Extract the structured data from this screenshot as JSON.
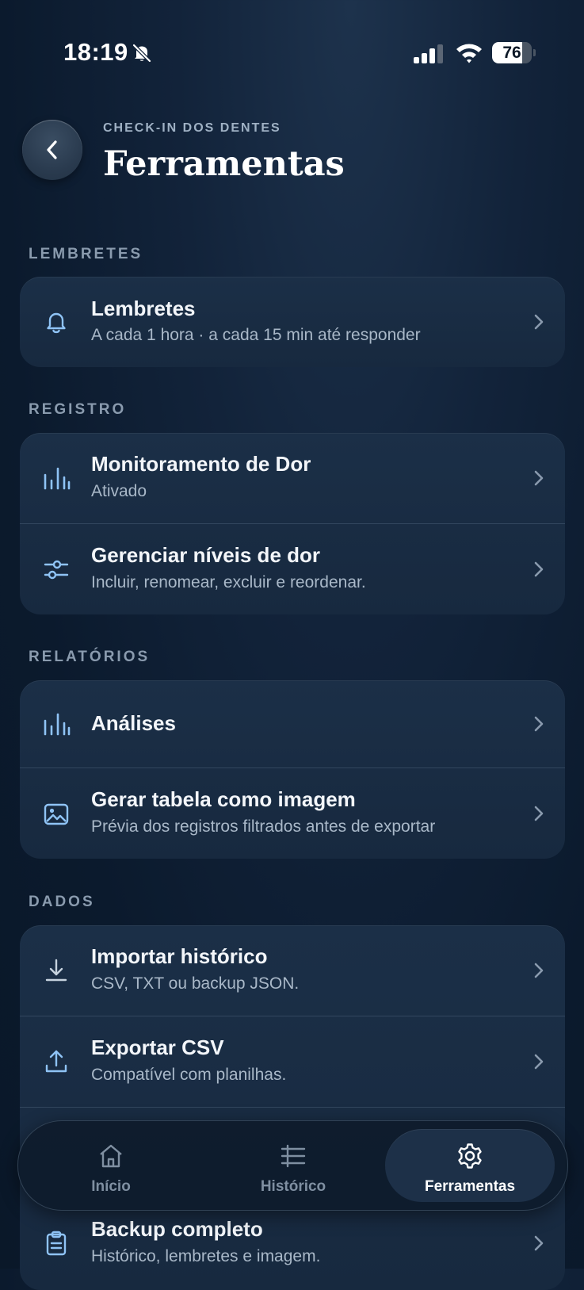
{
  "status_bar": {
    "time": "18:19",
    "battery": "76",
    "battery_level": 0.76
  },
  "header": {
    "eyebrow": "CHECK-IN DOS DENTES",
    "title": "Ferramentas"
  },
  "sections": {
    "lembretes": {
      "label": "LEMBRETES",
      "items": [
        {
          "title": "Lembretes",
          "subtitle": "A cada 1 hora · a cada 15 min até responder",
          "icon": "bell-icon"
        }
      ]
    },
    "registro": {
      "label": "REGISTRO",
      "items": [
        {
          "title": "Monitoramento de Dor",
          "subtitle": "Ativado",
          "icon": "bar-chart-icon"
        },
        {
          "title": "Gerenciar níveis de dor",
          "subtitle": "Incluir, renomear, excluir e reordenar.",
          "icon": "sliders-icon"
        }
      ]
    },
    "relatorios": {
      "label": "RELATÓRIOS",
      "items": [
        {
          "title": "Análises",
          "icon": "bar-chart-icon"
        },
        {
          "title": "Gerar tabela como imagem",
          "subtitle": "Prévia dos registros filtrados antes de exportar",
          "icon": "image-icon"
        }
      ]
    },
    "dados": {
      "label": "DADOS",
      "items": [
        {
          "title": "Importar histórico",
          "subtitle": "CSV, TXT ou backup JSON.",
          "icon": "download-icon"
        },
        {
          "title": "Exportar CSV",
          "subtitle": "Compatível com planilhas.",
          "icon": "upload-icon"
        },
        {
          "title": "Backup completo",
          "subtitle": "Histórico, lembretes e imagem.",
          "icon": "clipboard-icon"
        }
      ]
    }
  },
  "tab_bar": {
    "tabs": [
      {
        "label": "Início",
        "icon": "home-icon",
        "active": false
      },
      {
        "label": "Histórico",
        "icon": "list-icon",
        "active": false
      },
      {
        "label": "Ferramentas",
        "icon": "gear-icon",
        "active": true
      }
    ]
  },
  "colors": {
    "accent": "#8fc3f5",
    "background": "#0f2036",
    "card": "#1a2d44"
  }
}
